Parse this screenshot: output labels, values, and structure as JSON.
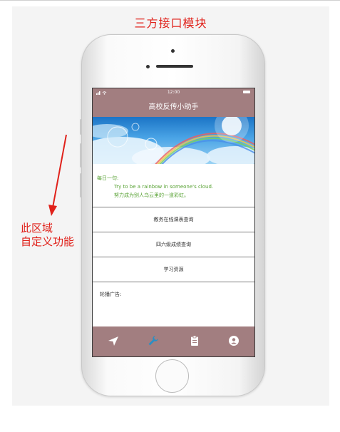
{
  "slide": {
    "title": "三方接口模块",
    "annotation_line1": "此区域",
    "annotation_line2": "自定义功能"
  },
  "status_bar": {
    "time": "12:00"
  },
  "app": {
    "title": "高校反传小助手",
    "quote_label": "每日一句:",
    "quote_en": "Try to be a rainbow in someone's cloud.",
    "quote_zh": "努力成为别人乌云里的一道彩虹。",
    "menu": [
      {
        "label": "教务在线课表查询"
      },
      {
        "label": "四六级成绩查询"
      },
      {
        "label": "学习资源"
      }
    ],
    "carousel_label": "轮播广告:"
  },
  "tabs": [
    {
      "icon": "paper-plane-icon",
      "active": false
    },
    {
      "icon": "wrench-icon",
      "active": true
    },
    {
      "icon": "clipboard-icon",
      "active": false
    },
    {
      "icon": "user-icon",
      "active": false
    }
  ],
  "colors": {
    "accent": "#a27e80",
    "annotation": "#e0211a",
    "quote": "#58a234",
    "active_tab": "#2a8fc4"
  }
}
